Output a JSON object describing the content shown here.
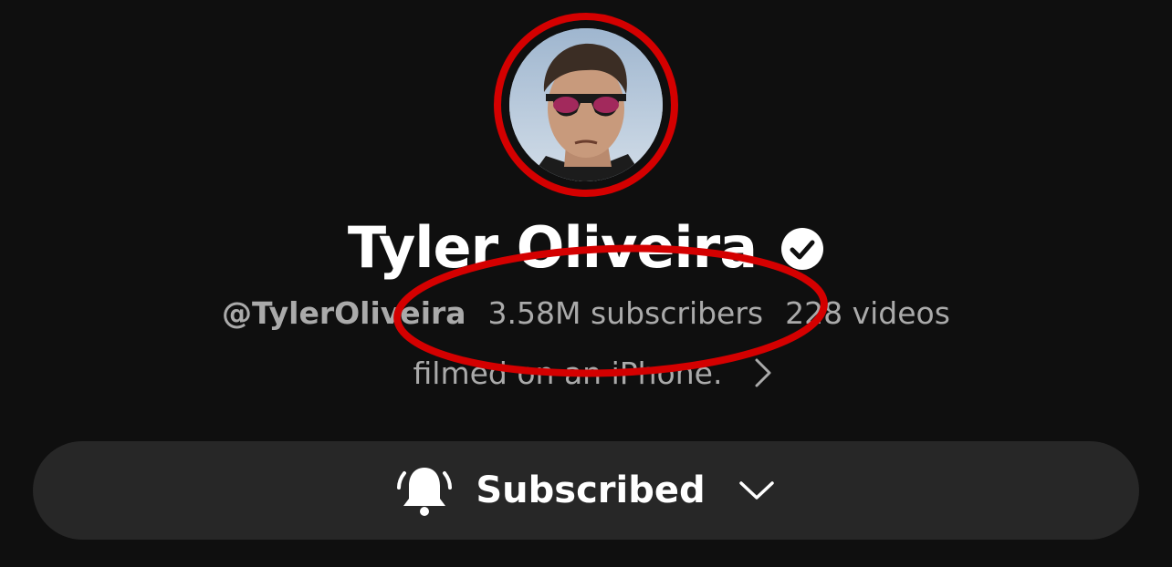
{
  "channel": {
    "name": "Tyler Oliveira",
    "handle": "@TylerOliveira",
    "subscribers": "3.58M subscribers",
    "videos": "228 videos",
    "description": "filmed on an iPhone."
  },
  "subscribe": {
    "label": "Subscribed"
  },
  "icons": {
    "verified": "verified-check-icon",
    "description_more": "chevron-right-icon",
    "bell": "bell-icon",
    "dropdown": "chevron-down-icon"
  },
  "colors": {
    "background": "#0f0f0f",
    "button_background": "#272727",
    "primary_text": "#ffffff",
    "secondary_text": "#aaaaaa",
    "annotation_red": "#d40000"
  }
}
